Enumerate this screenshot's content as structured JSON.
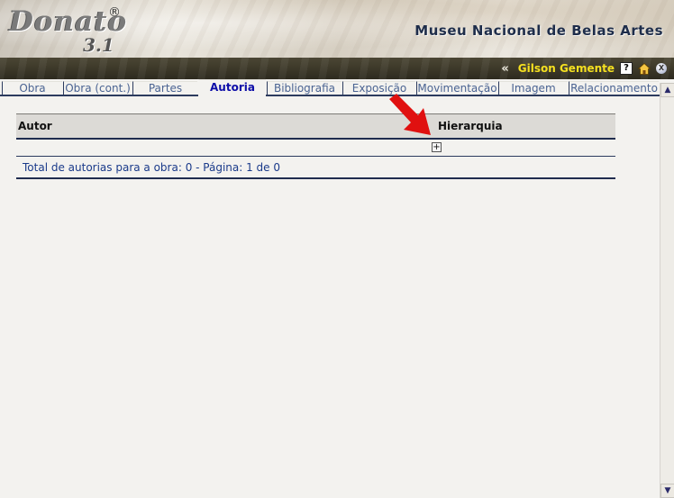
{
  "header": {
    "logo_text": "Donato",
    "logo_reg": "®",
    "logo_version": "3.1",
    "museum_title": "Museu Nacional de Belas Artes"
  },
  "userbar": {
    "chevron": "«",
    "username": "Gilson Gemente",
    "help_glyph": "?",
    "close_glyph": "X",
    "icons": [
      "help-icon",
      "home-icon",
      "close-icon"
    ]
  },
  "tabs": [
    {
      "label": "Obra",
      "active": false
    },
    {
      "label": "Obra (cont.)",
      "active": false
    },
    {
      "label": "Partes",
      "active": false
    },
    {
      "label": "Autoria",
      "active": true
    },
    {
      "label": "Bibliografia",
      "active": false
    },
    {
      "label": "Exposição",
      "active": false
    },
    {
      "label": "Movimentação",
      "active": false
    },
    {
      "label": "Imagem",
      "active": false
    },
    {
      "label": "Relacionamento",
      "active": false
    }
  ],
  "grid": {
    "columns": [
      "Autor",
      "Hierarquia"
    ],
    "add_glyph": "+",
    "footer": "Total de autorias para a obra: 0 - Página: 1 de 0"
  },
  "scrollbar": {
    "up_glyph": "▲",
    "down_glyph": "▼"
  },
  "colors": {
    "accent": "#2c3b5e",
    "username": "#f5e020",
    "active_tab": "#0d0da8",
    "arrow": "#e01010"
  }
}
